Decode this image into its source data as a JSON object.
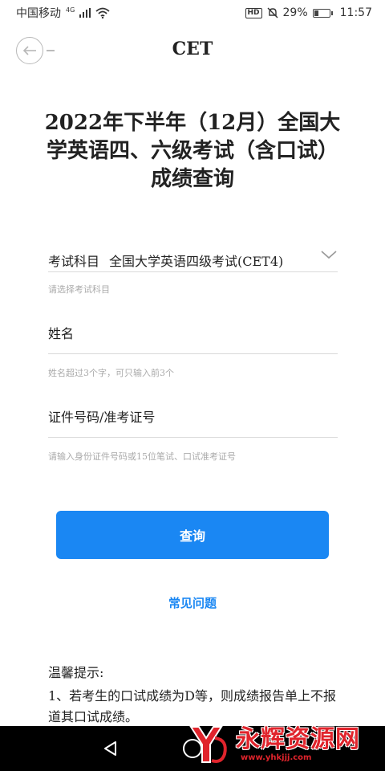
{
  "status_bar": {
    "carrier": "中国移动",
    "network": "4G",
    "hd": "HD",
    "battery_percent": "29%",
    "battery_level": 0.29,
    "time": "11:57"
  },
  "header": {
    "title": "CET"
  },
  "main_title": {
    "line1": "2022年下半年（12月）全国大",
    "line2": "学英语四、六级考试（含口试）",
    "line3": "成绩查询"
  },
  "form": {
    "subject": {
      "label": "考试科目",
      "value": "全国大学英语四级考试(CET4)",
      "hint": "请选择考试科目"
    },
    "name": {
      "label": "姓名",
      "hint": "姓名超过3个字，可只输入前3个"
    },
    "id_number": {
      "label": "证件号码/准考证号",
      "hint": "请输入身份证件号码或15位笔试、口试准考证号"
    },
    "submit_label": "查询",
    "faq_label": "常见问题"
  },
  "tips": {
    "title": "温馨提示:",
    "item1": "1、若考生的口试成绩为D等，则成绩报告单上不报道其口试成绩。"
  },
  "watermark": {
    "text": "永辉资源网",
    "url": "www.yhkjjj.com"
  },
  "colors": {
    "accent": "#1a87f3",
    "watermark": "#e0242c"
  }
}
